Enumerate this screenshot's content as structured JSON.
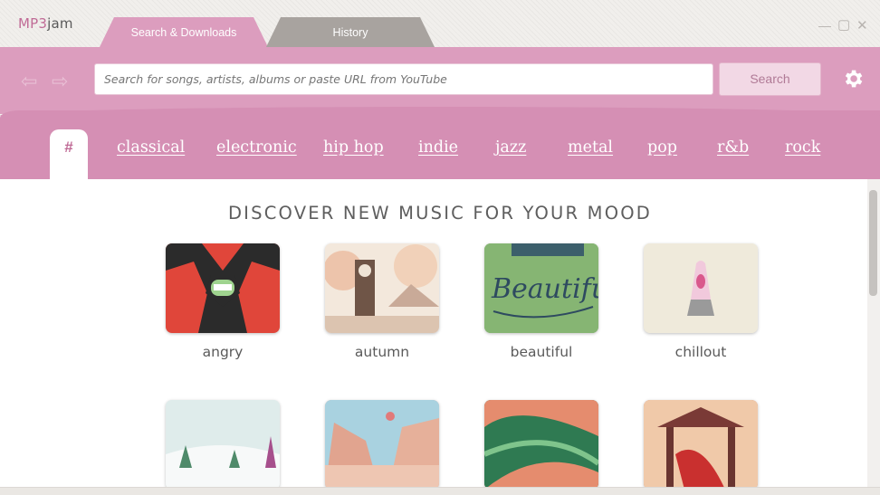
{
  "app": {
    "logo_prefix": "MP3",
    "logo_suffix": "jam"
  },
  "tabs": [
    {
      "label": "Search & Downloads",
      "active": true
    },
    {
      "label": "History",
      "active": false
    }
  ],
  "window_controls": {
    "minimize": "—",
    "maximize": "▢",
    "close": "✕"
  },
  "toolbar": {
    "back_icon": "⇦",
    "forward_icon": "⇨",
    "search_placeholder": "Search for songs, artists, albums or paste URL from YouTube",
    "search_value": "",
    "search_button": "Search"
  },
  "genres": {
    "hash": "#",
    "items": [
      "classical",
      "electronic",
      "hip hop",
      "indie",
      "jazz",
      "metal",
      "pop",
      "r&b",
      "rock"
    ]
  },
  "main": {
    "heading": "DISCOVER NEW MUSIC FOR YOUR MOOD",
    "moods": [
      {
        "label": "angry"
      },
      {
        "label": "autumn"
      },
      {
        "label": "beautiful"
      },
      {
        "label": "chillout"
      },
      {
        "label": ""
      },
      {
        "label": ""
      },
      {
        "label": ""
      },
      {
        "label": ""
      }
    ],
    "beautiful_art_text": "Beautiful"
  },
  "colors": {
    "accent": "#dc9dbe",
    "genre_bar": "#d58fb4",
    "logo_pink": "#c06b96",
    "inactive_tab": "#a8a39f"
  }
}
